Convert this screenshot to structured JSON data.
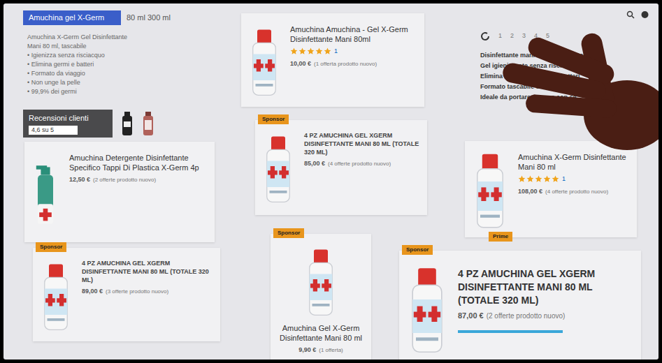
{
  "collage": {
    "header": {
      "search": "Amuchina gel X-Germ",
      "tail": "80 ml 300 ml",
      "lines": [
        "Amuchina X-Germ Gel Disinfettante",
        "Mani 80 ml, tascabile",
        "• Igienizza senza risciacquo",
        "• Elimina germi e batteri",
        "• Formato da viaggio",
        "• Non unge la pelle",
        "• 99,9% dei germi"
      ]
    },
    "reviews": {
      "label": "Recensioni clienti",
      "value": "4,6 su 5"
    },
    "detail": {
      "links": [
        "1",
        "2",
        "3",
        "4",
        "5"
      ],
      "lines": [
        "Disinfettante mani Amuchina X-Germ",
        "Gel igienizzante senza risciacquo",
        "Elimina il 99,9% di germi e batteri",
        "Formato tascabile da 80 ml",
        "Ideale da portare sempre con sé"
      ]
    },
    "cards": [
      {
        "kind": "row",
        "product": "gel",
        "badge": "",
        "title": "Amuchina Amuchina - Gel X-Germ Disinfettante Mani 80ml",
        "stars": 5,
        "count": "1",
        "price": "10,00 €",
        "offers": "(1 offerta prodotto nuovo)"
      },
      {
        "kind": "row",
        "product": "spray",
        "badge": "",
        "title": "Amuchina Detergente Disinfettante Specifico Tappi Di Plastica X-Germ 4p",
        "stars": 0,
        "count": "",
        "price": "12,50 €",
        "offers": "(2 offerte prodotto nuovo)"
      },
      {
        "kind": "row",
        "product": "gel",
        "badge": "Sponsor",
        "title": "4 PZ AMUCHINA GEL XGERM DISINFETTANTE MANI 80 ML (TOTALE 320 ML)",
        "stars": 0,
        "count": "",
        "price": "85,00 €",
        "offers": "(4 offerte prodotto nuovo)"
      },
      {
        "kind": "row",
        "product": "gel",
        "badge": "Prime",
        "title": "Amuchina X-Germ Disinfettante Mani 80 ml",
        "stars": 5,
        "count": "1",
        "price": "108,00 €",
        "offers": "(4 offerte prodotto nuovo)"
      },
      {
        "kind": "row",
        "product": "gel",
        "badge": "Sponsor",
        "title": "4 PZ AMUCHINA GEL XGERM DISINFETTANTE MANI 80 ML (TOTALE 320 ML)",
        "stars": 0,
        "count": "",
        "price": "89,00 €",
        "offers": "(3 offerte prodotto nuovo)"
      },
      {
        "kind": "stack",
        "product": "gel",
        "badge": "Sponsor",
        "title": "Amuchina Gel X-Germ Disinfettante Mani 80 ml",
        "stars": 0,
        "count": "",
        "price": "9,90 €",
        "offers": "(1 offerta)"
      },
      {
        "kind": "big",
        "product": "gel",
        "badge": "Sponsor",
        "title": "4 PZ AMUCHINA GEL XGERM DISINFETTANTE MANI 80 ML (TOTALE 320 ML)",
        "stars": 0,
        "count": "",
        "price": "87,00 €",
        "offers": "(2 offerte prodotto nuovo)"
      }
    ]
  }
}
